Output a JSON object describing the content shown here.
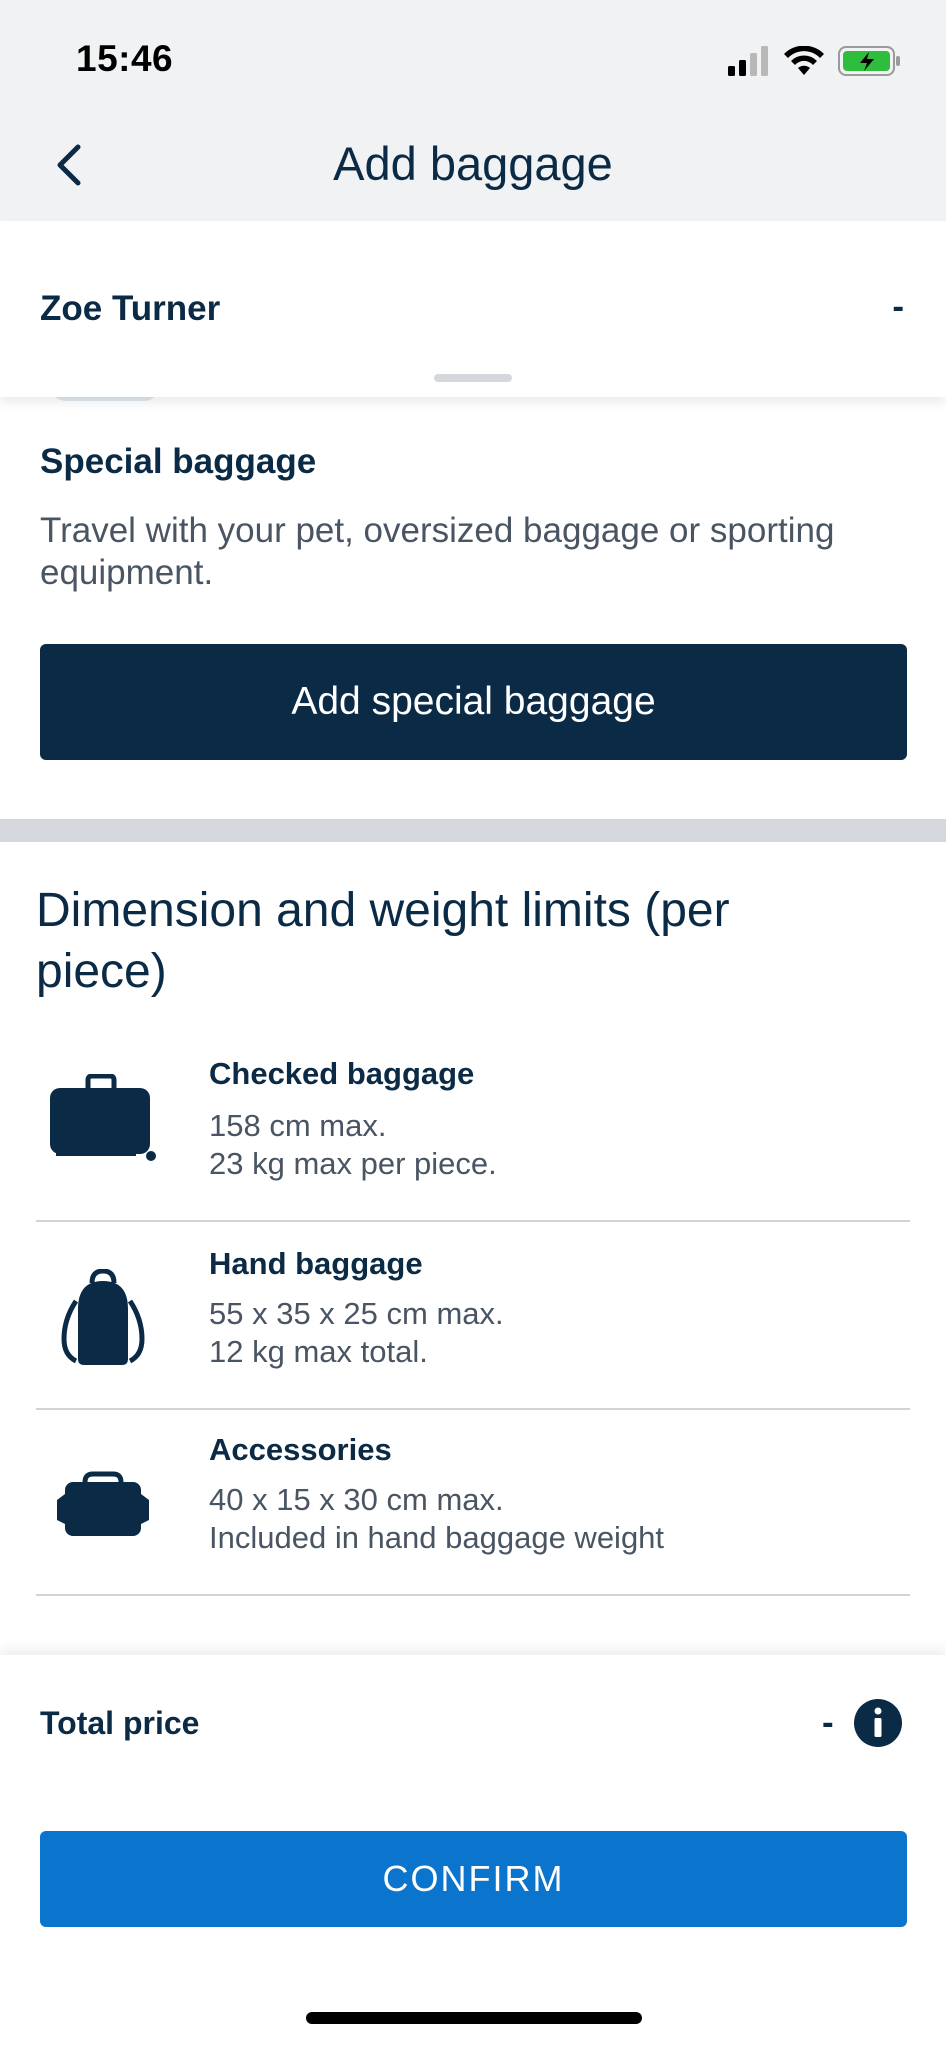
{
  "status_bar": {
    "time": "15:46"
  },
  "header": {
    "title": "Add baggage"
  },
  "passenger": {
    "name": "Zoe Turner",
    "price": "-"
  },
  "special_baggage": {
    "title": "Special baggage",
    "description": "Travel with your pet, oversized baggage or sporting equipment.",
    "button_label": "Add special baggage"
  },
  "limits": {
    "title": "Dimension and weight limits (per piece)",
    "items": [
      {
        "name": "Checked baggage",
        "icon": "suitcase-icon",
        "line1": "158 cm max.",
        "line2": "23 kg max per piece."
      },
      {
        "name": "Hand baggage",
        "icon": "backpack-icon",
        "line1": "55 x 35 x 25 cm max.",
        "line2": "12 kg max total."
      },
      {
        "name": "Accessories",
        "icon": "handbag-icon",
        "line1": "40 x 15 x 30 cm max.",
        "line2": "Included in hand baggage weight"
      }
    ]
  },
  "footer": {
    "total_label": "Total price",
    "total_value": "-",
    "confirm_label": "CONFIRM"
  },
  "colors": {
    "primary_dark": "#0a2a45",
    "accent_blue": "#0b74cc",
    "battery_green": "#2ebd3c"
  }
}
